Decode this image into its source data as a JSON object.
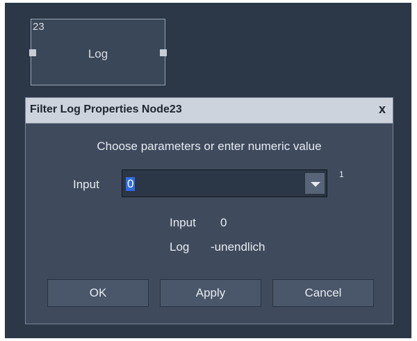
{
  "node": {
    "id": "23",
    "label": "Log"
  },
  "dialog": {
    "title": "Filter Log Properties Node23",
    "close_label": "x",
    "hint": "Choose parameters or enter numeric value",
    "input_label": "Input",
    "input_value": "0",
    "superscript": "1",
    "readout": {
      "input_key": "Input",
      "input_value": "0",
      "log_key": "Log",
      "log_value": "-unendlich"
    },
    "buttons": {
      "ok": "OK",
      "apply": "Apply",
      "cancel": "Cancel"
    }
  },
  "icons": {
    "dropdown": "chevron-down-icon",
    "close": "close-icon"
  },
  "colors": {
    "canvas": "#2c3848",
    "dialog": "#3f4b5d",
    "titlebar": "#ccd3dc",
    "selection": "#2f6be0"
  }
}
